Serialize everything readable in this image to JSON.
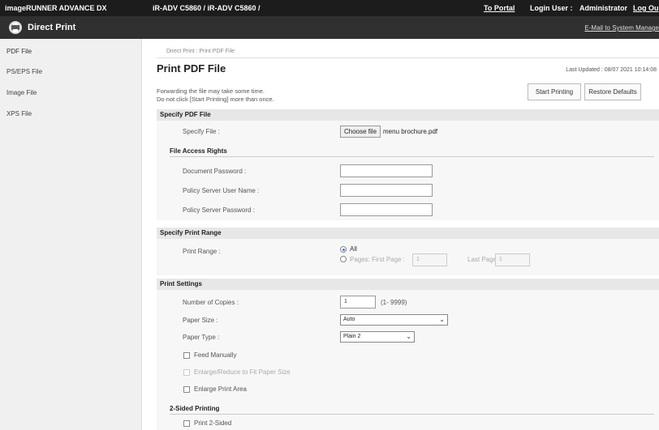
{
  "header": {
    "product": "imageRUNNER ADVANCE DX",
    "model": "iR-ADV C5860 / iR-ADV C5860 /",
    "to_portal": "To Portal",
    "login_label": "Login User :",
    "login_user": "Administrator",
    "logout": "Log Ou",
    "app_title": "Direct Print",
    "mail_link": "E-Mail to System Manage"
  },
  "sidebar": {
    "items": [
      {
        "label": "PDF File"
      },
      {
        "label": "PS/EPS File"
      },
      {
        "label": "Image File"
      },
      {
        "label": "XPS File"
      }
    ]
  },
  "main": {
    "breadcrumb": "Direct Print : Print PDF File",
    "title": "Print PDF File",
    "last_updated": "Last Updated : 08/07 2021 10:14:08",
    "note_line1": "Forwarding the file may take some time.",
    "note_line2": "Do not click [Start Printing] more than once.",
    "start_printing": "Start Printing",
    "restore_defaults": "Restore Defaults"
  },
  "specify_file": {
    "heading": "Specify PDF File",
    "file_label": "Specify File :",
    "choose_button": "Choose file",
    "file_name": "menu brochure.pdf",
    "access_heading": "File Access Rights",
    "doc_password_label": "Document Password :",
    "doc_password_value": "",
    "policy_user_label": "Policy Server User Name :",
    "policy_user_value": "",
    "policy_password_label": "Policy Server Password :",
    "policy_password_value": ""
  },
  "print_range": {
    "heading": "Specify Print Range",
    "label": "Print Range :",
    "all_label": "All",
    "pages_label": "Pages: First Page :",
    "first_page_value": "1",
    "last_page_label": "Last Page :",
    "last_page_value": "1",
    "selected": "All"
  },
  "print_settings": {
    "heading": "Print Settings",
    "copies_label": "Number of Copies :",
    "copies_value": "1",
    "copies_range": "(1- 9999)",
    "paper_size_label": "Paper Size :",
    "paper_size_value": "Auto",
    "paper_type_label": "Paper Type :",
    "paper_type_value": "Plain 2",
    "feed_manually": "Feed Manually",
    "enlarge_reduce": "Enlarge/Reduce to Fit Paper Size",
    "enlarge_area": "Enlarge Print Area",
    "two_sided_heading": "2-Sided Printing",
    "print_two_sided": "Print 2-Sided"
  }
}
